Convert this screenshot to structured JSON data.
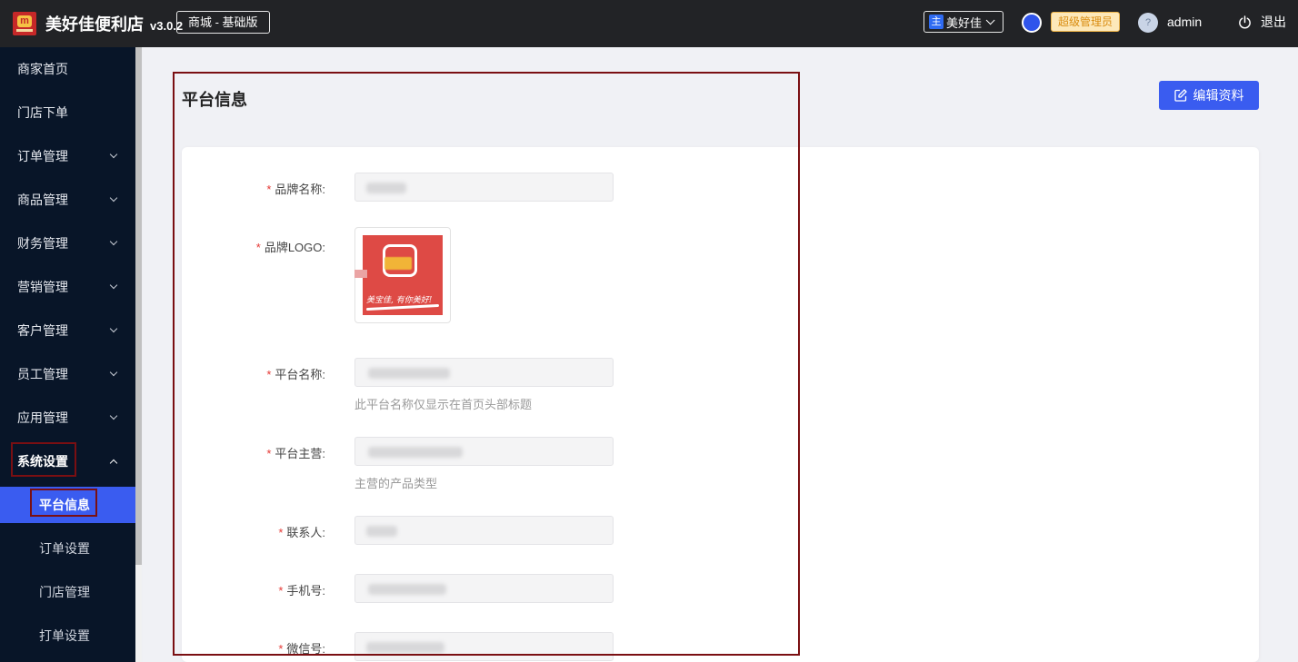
{
  "header": {
    "brand": "美好佳便利店",
    "version": "v3.0.2",
    "edition": "商城 - 基础版",
    "store_tag": "主",
    "store_name": "美好佳",
    "role": "超级管理员",
    "username": "admin",
    "logout": "退出",
    "avatar_char": "?"
  },
  "sidebar": {
    "items": [
      {
        "label": "商家首页"
      },
      {
        "label": "门店下单"
      },
      {
        "label": "订单管理"
      },
      {
        "label": "商品管理"
      },
      {
        "label": "财务管理"
      },
      {
        "label": "营销管理"
      },
      {
        "label": "客户管理"
      },
      {
        "label": "员工管理"
      },
      {
        "label": "应用管理"
      },
      {
        "label": "系统设置"
      }
    ],
    "sub_items": [
      {
        "label": "平台信息"
      },
      {
        "label": "订单设置"
      },
      {
        "label": "门店管理"
      },
      {
        "label": "打单设置"
      }
    ]
  },
  "main": {
    "title": "平台信息",
    "edit_button": "编辑资料",
    "form": {
      "brand_name_label": "品牌名称:",
      "brand_logo_label": "品牌LOGO:",
      "logo_script": "美宝佳, 有你美好!",
      "platform_name_label": "平台名称:",
      "platform_name_hint": "此平台名称仅显示在首页头部标题",
      "main_business_label": "平台主营:",
      "main_business_hint": "主营的产品类型",
      "contact_label": "联系人:",
      "phone_label": "手机号:",
      "wechat_label": "微信号:"
    }
  },
  "colors": {
    "topbar": "#222326",
    "sidebar": "#081528",
    "accent": "#3a5cf0",
    "highlight_border": "#7a0f12",
    "required": "#e53935"
  }
}
